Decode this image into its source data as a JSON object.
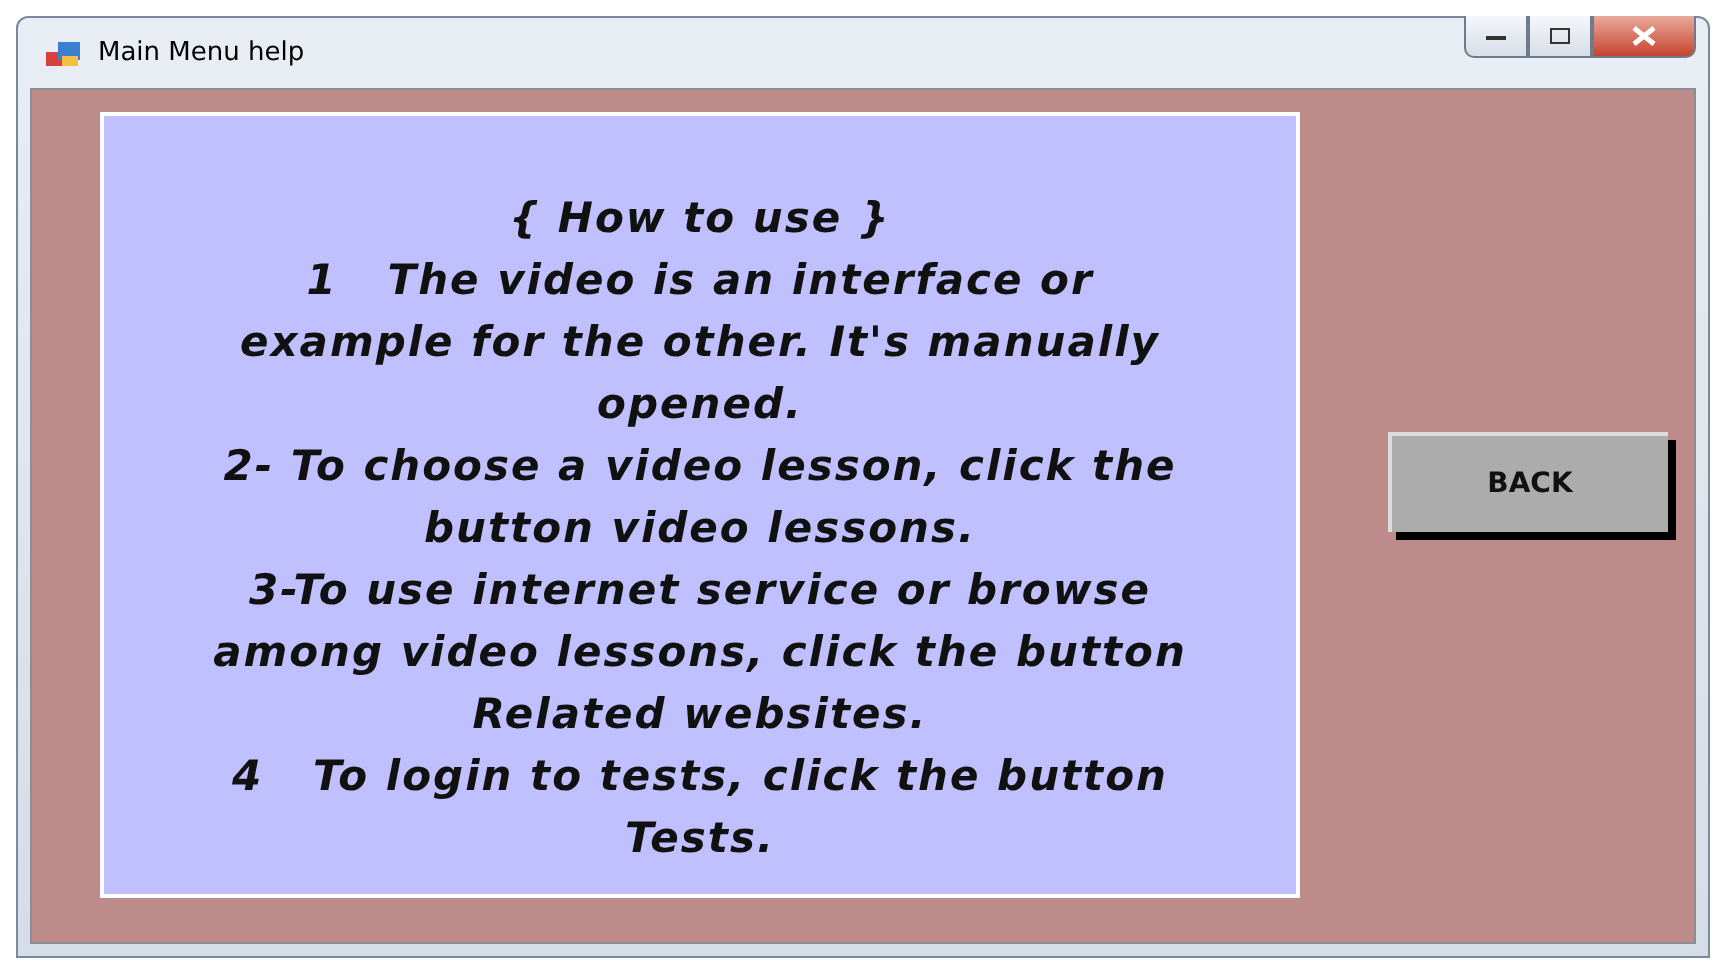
{
  "window": {
    "title": "Main Menu help"
  },
  "help_lines": [
    "{ How to use }",
    "1   The video is an interface or",
    "example for the other. It's manually",
    "opened.",
    "2- To choose a video lesson, click the",
    "button video lessons.",
    "3-To use internet service or browse",
    "among video lessons, click the button",
    "Related websites.",
    "4   To login to tests, click the button",
    "Tests."
  ],
  "buttons": [
    "BACK"
  ]
}
